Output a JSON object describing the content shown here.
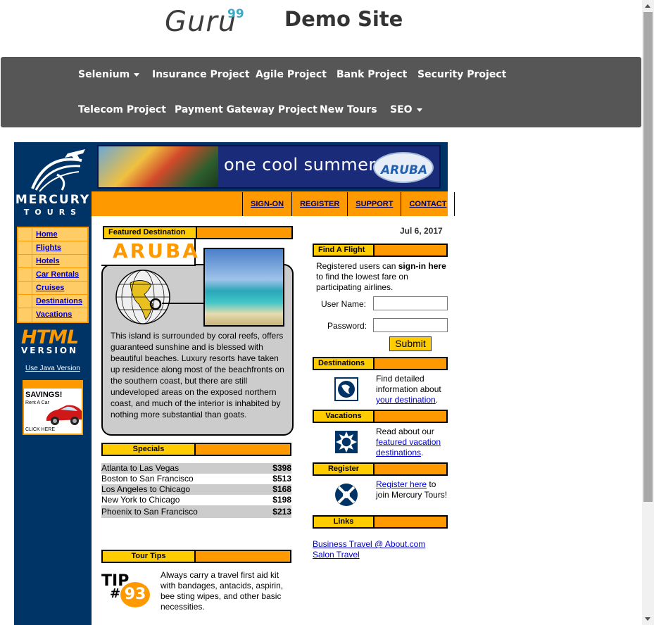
{
  "header": {
    "logo_word": "Guru",
    "logo_sup": "99",
    "site_title": "Demo Site"
  },
  "navbar": {
    "row1": [
      "Selenium",
      "Insurance Project",
      "Agile Project",
      "Bank Project",
      "Security Project"
    ],
    "row2": [
      "Telecom Project",
      "Payment Gateway Project",
      "New Tours",
      "SEO"
    ]
  },
  "sidebar": {
    "brand": "MERCURY",
    "brand_sub": "TOURS",
    "menu": [
      "Home",
      "Flights",
      "Hotels",
      "Car Rentals",
      "Cruises",
      "Destinations",
      "Vacations"
    ],
    "html_label": "HTML",
    "version_label": "VERSION",
    "java_link": "Use Java Version",
    "ad": {
      "title": "SAVINGS!",
      "sub": "Rent A Car",
      "cta": "CLICK HERE"
    }
  },
  "banner": {
    "text": "one cool summer",
    "logo": "ARUBA"
  },
  "top_links": [
    "SIGN-ON",
    "REGISTER",
    "SUPPORT",
    "CONTACT"
  ],
  "featured": {
    "header": "Featured Destination",
    "title": "ARUBA",
    "text": "This island is surrounded by coral reefs, offers guaranteed sunshine and is blessed with beautiful beaches. Luxury resorts have taken up residence along most of the beachfronts on the southern coast, but there are still undeveloped areas on the exposed northern coast, and much of the interior is inhabited by nothing more substantial than goats."
  },
  "specials": {
    "header": "Specials",
    "rows": [
      {
        "route": "Atlanta to Las Vegas",
        "price": "$398"
      },
      {
        "route": "Boston to San Francisco",
        "price": "$513"
      },
      {
        "route": "Los Angeles to Chicago",
        "price": "$168"
      },
      {
        "route": "New York to Chicago",
        "price": "$198"
      },
      {
        "route": "Phoenix to San Francisco",
        "price": "$213"
      }
    ]
  },
  "tour_tips": {
    "header": "Tour Tips",
    "tip_word": "TIP",
    "tip_hash": "#",
    "tip_number": "93",
    "text": "Always carry a travel first aid kit with bandages, antacids, aspirin, bee sting wipes, and other basic necessities."
  },
  "right": {
    "date": "Jul 6, 2017",
    "find_flight_header": "Find A Flight",
    "login_intro_1": "Registered users can ",
    "login_intro_bold": "sign-in here",
    "login_intro_2": " to find the lowest fare on participating airlines.",
    "username_label": "User Name:",
    "password_label": "Password:",
    "username_value": "",
    "password_value": "",
    "submit_label": "Submit",
    "destinations_header": "Destinations",
    "destinations_text": "Find detailed information about ",
    "destinations_link": "your destination",
    "destinations_end": ".",
    "vacations_header": "Vacations",
    "vacations_text": "Read about our ",
    "vacations_link": "featured vacation destinations",
    "vacations_end": ".",
    "register_header": "Register",
    "register_link": "Register here",
    "register_text": " to join Mercury Tours!",
    "links_header": "Links",
    "links": [
      "Business Travel @ About.com",
      "Salon Travel"
    ]
  }
}
